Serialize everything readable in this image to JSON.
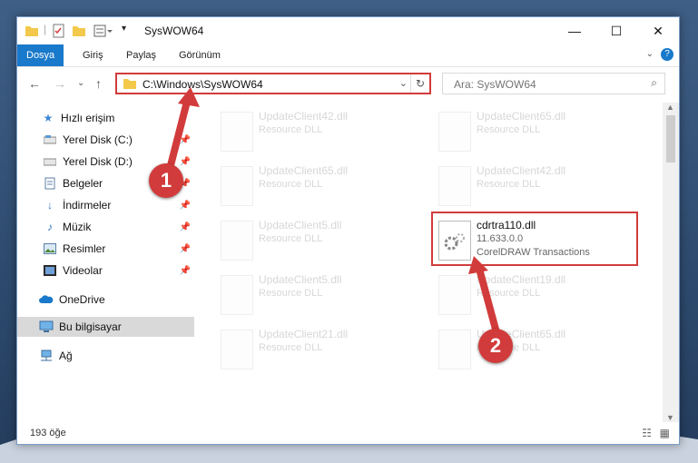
{
  "window": {
    "title": "SysWOW64",
    "minimize": "—",
    "maximize": "☐",
    "close": "✕"
  },
  "ribbon": {
    "tabs": [
      "Dosya",
      "Giriş",
      "Paylaş",
      "Görünüm"
    ],
    "help": "?"
  },
  "navigation": {
    "address": "C:\\Windows\\SysWOW64",
    "search_placeholder": "Ara: SysWOW64"
  },
  "sidebar": {
    "items": [
      {
        "label": "Hızlı erişim",
        "icon": "star-icon"
      },
      {
        "label": "Yerel Disk (C:)",
        "icon": "drive-icon"
      },
      {
        "label": "Yerel Disk (D:)",
        "icon": "drive-icon"
      },
      {
        "label": "Belgeler",
        "icon": "documents-icon"
      },
      {
        "label": "İndirmeler",
        "icon": "download-icon"
      },
      {
        "label": "Müzik",
        "icon": "music-icon"
      },
      {
        "label": "Resimler",
        "icon": "pictures-icon"
      },
      {
        "label": "Videolar",
        "icon": "videos-icon"
      },
      {
        "label": "OneDrive",
        "icon": "cloud-icon"
      },
      {
        "label": "Bu bilgisayar",
        "icon": "computer-icon"
      },
      {
        "label": "Ağ",
        "icon": "network-icon"
      }
    ]
  },
  "files": [
    {
      "name": "UpdateClient42.dll",
      "desc": "Resource DLL"
    },
    {
      "name": "UpdateClient65.dll",
      "desc": "Resource DLL"
    },
    {
      "name": "UpdateClient65.dll",
      "desc": "Resource DLL"
    },
    {
      "name": "UpdateClient42.dll",
      "desc": "Resource DLL"
    },
    {
      "name": "UpdateClient5.dll",
      "desc": "Resource DLL"
    },
    {
      "name": "cdrtra110.dll",
      "version": "11.633.0.0",
      "desc": "CorelDRAW Transactions"
    },
    {
      "name": "UpdateClient5.dll",
      "desc": "Resource DLL"
    },
    {
      "name": "UpdateClient19.dll",
      "desc": "Resource DLL"
    },
    {
      "name": "UpdateClient21.dll",
      "desc": "Resource DLL"
    },
    {
      "name": "UpdateClient65.dll",
      "desc": "Resource DLL"
    }
  ],
  "status": {
    "count": "193 öğe"
  },
  "annotations": [
    "1",
    "2"
  ],
  "colors": {
    "highlight": "#d23b3b",
    "ribbon_active": "#1979ca"
  }
}
